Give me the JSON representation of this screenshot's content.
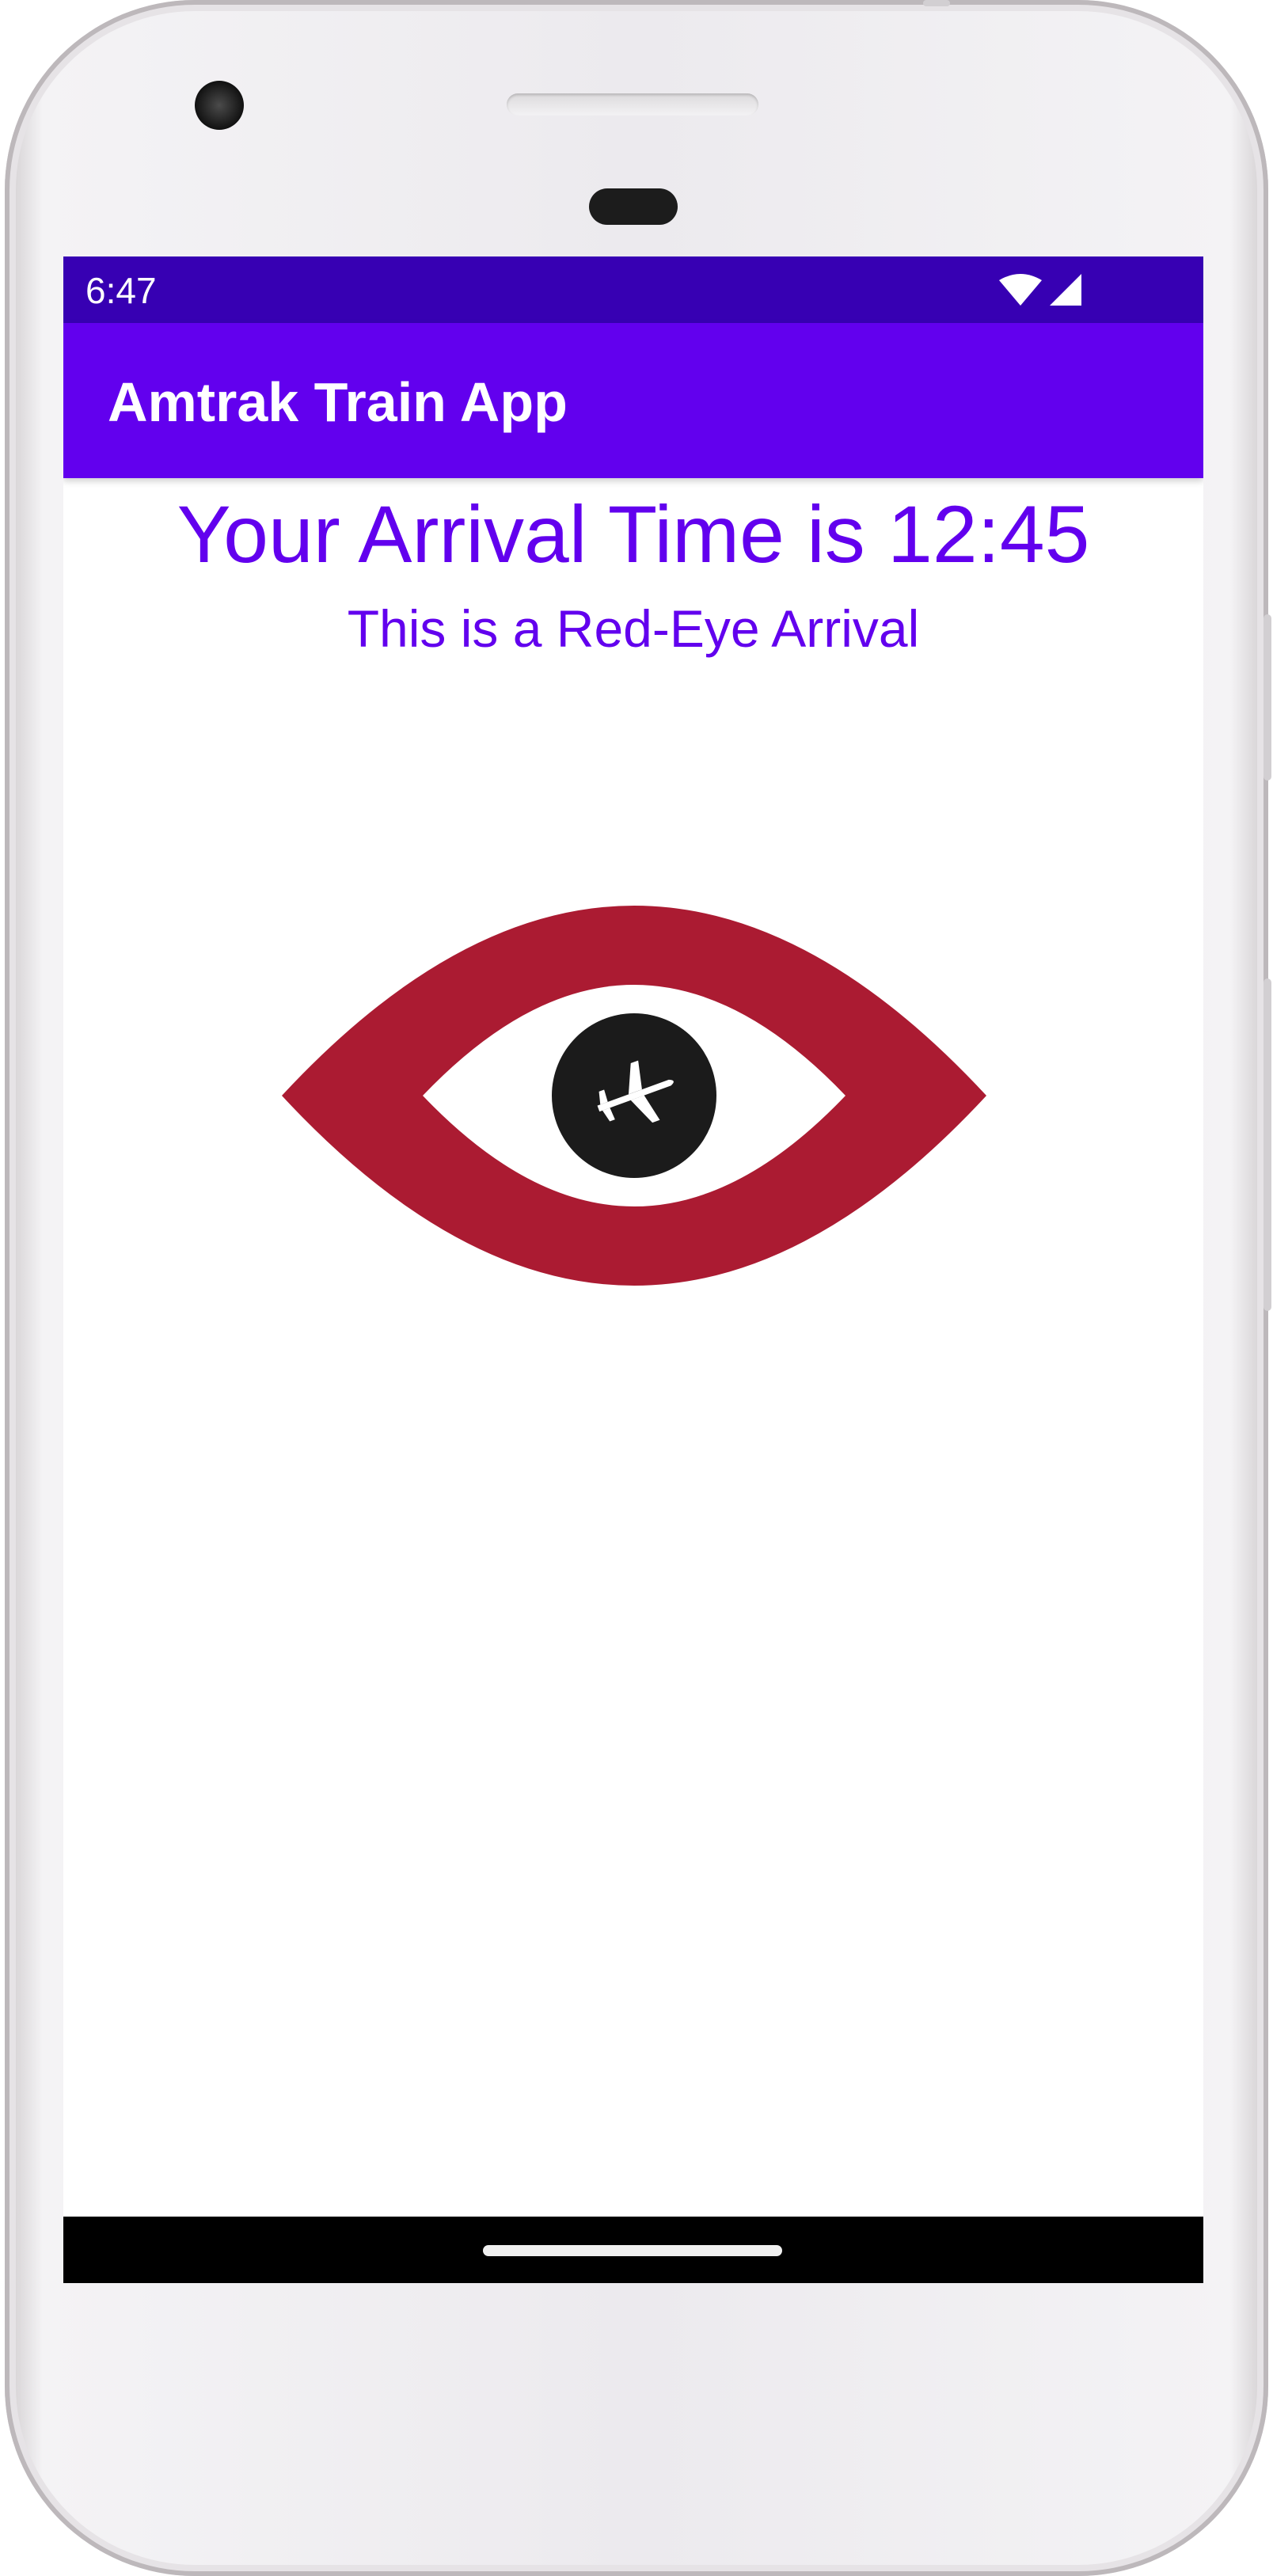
{
  "status_bar": {
    "time": "6:47",
    "icons": [
      "wifi-icon",
      "cell-signal-icon"
    ],
    "color": "#3700b3"
  },
  "app_bar": {
    "title": "Amtrak Train App",
    "color": "#6200ee"
  },
  "main": {
    "arrival_time_text": "Your Arrival Time is 12:45",
    "arrival_note": "This is a Red-Eye Arrival",
    "text_color": "#6200ee",
    "image": {
      "icon": "red-eye-airplane-icon",
      "eye_color": "#ab1b32",
      "pupil_color": "#1b1b1b"
    }
  },
  "nav_bar": {
    "color": "#000000"
  }
}
